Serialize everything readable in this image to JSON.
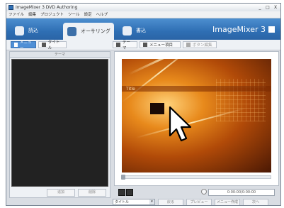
{
  "window": {
    "title": "ImageMixer 3 DVD Authoring",
    "controls": [
      "_",
      "□",
      "X"
    ]
  },
  "menu": [
    "ファイル",
    "編集",
    "プロジェクト",
    "ツール",
    "設定",
    "ヘルプ"
  ],
  "modes": [
    {
      "label": "読込",
      "icon": "import-icon",
      "active": false
    },
    {
      "label": "オーサリング",
      "icon": "authoring-icon",
      "active": true
    },
    {
      "label": "書込",
      "icon": "write-disc-icon",
      "active": false
    }
  ],
  "logo": "ImageMixer 3",
  "toolbar": {
    "left": [
      {
        "label": "メニュー",
        "active": true
      },
      {
        "label": "タイトル",
        "active": false
      }
    ],
    "right": [
      "テーマ",
      "メニュー項目",
      "ボタン編集"
    ]
  },
  "left_panel": {
    "header": "テーマ",
    "buttons": [
      "追加",
      "削除"
    ]
  },
  "preview": {
    "title_text": "Title"
  },
  "controls": {
    "timecode": "0:00:00/0:00:00"
  },
  "bottom": {
    "select_value": "タイトル",
    "buttons": [
      "戻る",
      "プレビュー",
      "メニュー作成",
      "次へ"
    ]
  },
  "colors": {
    "accent": "#2f6fb4",
    "preview_orange": "#e88a1c"
  }
}
